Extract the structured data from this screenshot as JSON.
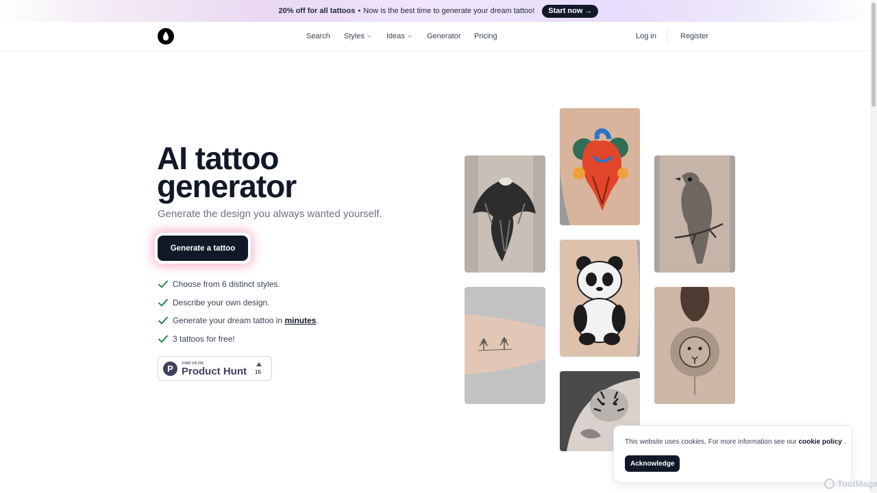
{
  "banner": {
    "discount": "20% off for all tattoos",
    "separator": "•",
    "message": "Now is the best time to generate your dream tattoo!",
    "cta": "Start now →"
  },
  "nav": {
    "logo_icon": "drop-logo-icon",
    "links": [
      "Search",
      "Styles",
      "Ideas",
      "Generator",
      "Pricing"
    ],
    "login": "Log in",
    "register": "Register"
  },
  "hero": {
    "title_line1": "AI tattoo",
    "title_line2": "generator",
    "subtitle": "Generate the design you always wanted yourself.",
    "cta": "Generate a tattoo",
    "features": [
      {
        "text": "Choose from 6 distinct styles."
      },
      {
        "text": "Describe your own design."
      },
      {
        "text_before": "Generate your dream tattoo in ",
        "link": "minutes",
        "text_after": "."
      },
      {
        "text": "3 tattoos for free!"
      }
    ],
    "product_hunt": {
      "small": "FIND US ON",
      "name": "Product Hunt",
      "logo_letter": "P",
      "upvotes": "16"
    }
  },
  "gallery": {
    "images": [
      "eagle-tattoo",
      "anatomical-heart-tattoo",
      "bird-tattoo",
      "panda-tattoo",
      "trees-tattoo",
      "lion-back-tattoo",
      "tiger-tattoo"
    ]
  },
  "cookie": {
    "text": "This website uses cookies. For more information see our",
    "policy_link": "cookie policy",
    "period": ".",
    "button": "Acknowledge"
  },
  "watermark": "ToolMage",
  "colors": {
    "primary": "#111827",
    "accent_glow": "#ec70a0",
    "check": "#15803d"
  }
}
